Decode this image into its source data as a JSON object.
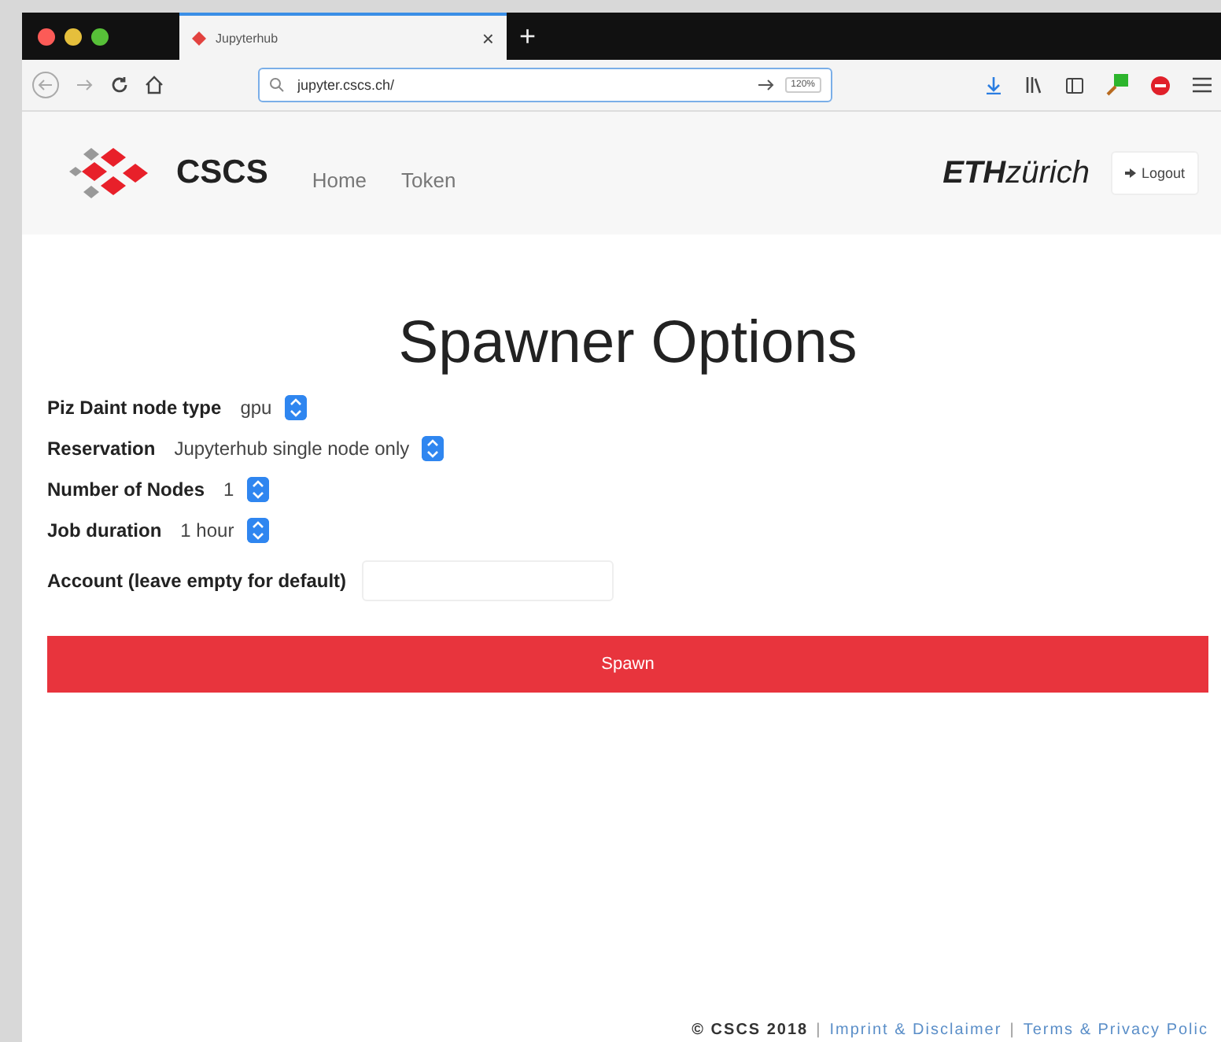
{
  "browser": {
    "tab": {
      "title": "Jupyterhub",
      "selected": true
    },
    "close_tab": "×",
    "new_tab": "+",
    "address": "jupyter.cscs.ch/",
    "zoom": "120%"
  },
  "header": {
    "logo": "CSCS",
    "nav": [
      {
        "label": "Home"
      },
      {
        "label": "Token"
      }
    ],
    "partner_bold": "ETH",
    "partner_rest": "zürich",
    "logout": "Logout"
  },
  "title": "Spawner Options",
  "fields": [
    {
      "kind": "select",
      "label": "Piz Daint node type",
      "value": "gpu"
    },
    {
      "kind": "select",
      "label": "Reservation",
      "value": "Jupyterhub single node only"
    },
    {
      "kind": "select",
      "label": "Number of Nodes",
      "value": "1"
    },
    {
      "kind": "select",
      "label": "Job duration",
      "value": "1 hour"
    },
    {
      "kind": "text",
      "label": "Account (leave empty for default)"
    }
  ],
  "spawn_button": "Spawn",
  "footer": {
    "copyright": "© CSCS 2018",
    "separator": "|",
    "links": [
      "Imprint & Disclaimer",
      "Terms & Privacy Polic"
    ]
  }
}
